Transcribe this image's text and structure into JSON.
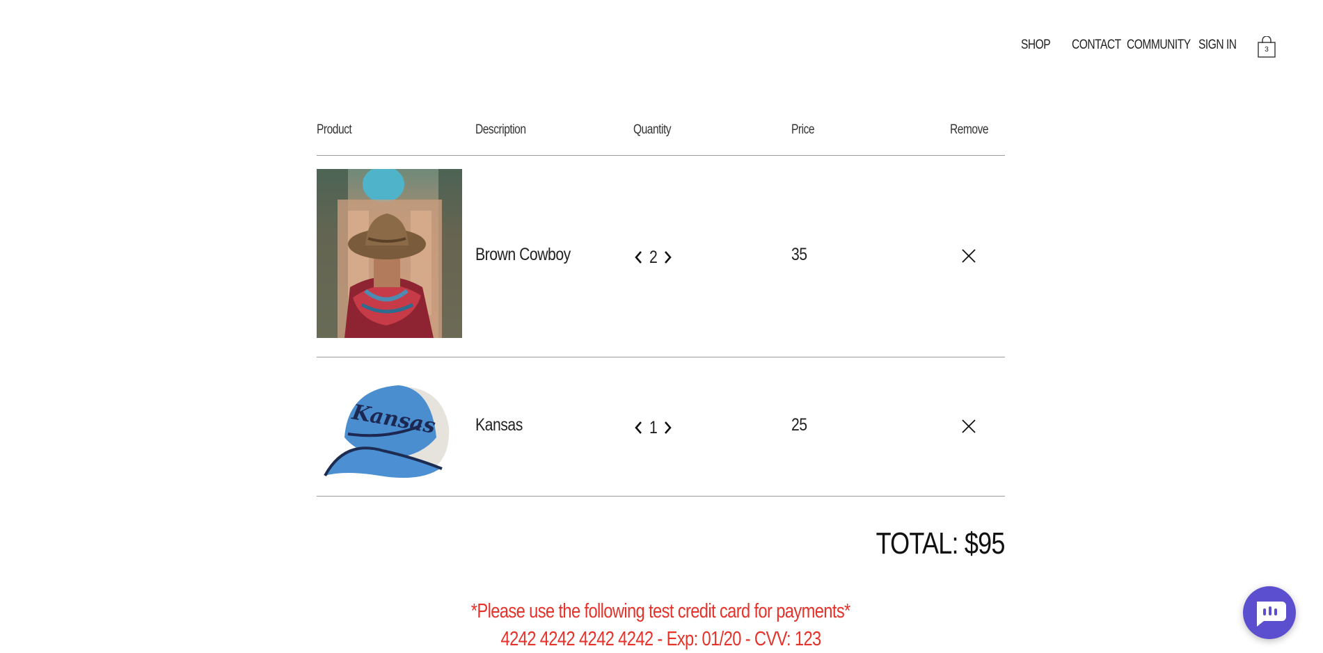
{
  "nav": {
    "items": [
      {
        "label": "SHOP"
      },
      {
        "label": "CONTACT"
      },
      {
        "label": "COMMUNITY"
      },
      {
        "label": "SIGN IN"
      }
    ],
    "cart_count": "3"
  },
  "cart": {
    "headers": {
      "product": "Product",
      "description": "Description",
      "quantity": "Quantity",
      "price": "Price",
      "remove": "Remove"
    },
    "items": [
      {
        "description": "Brown Cowboy",
        "quantity": "2",
        "price": "35",
        "image": "cowboy-hat-photo"
      },
      {
        "description": "Kansas",
        "quantity": "1",
        "price": "25",
        "image": "kansas-cap-photo"
      }
    ],
    "total": "TOTAL: $95"
  },
  "notice": {
    "line1": "*Please use the following test credit card for payments*",
    "line2": "4242 4242 4242 4242 - Exp: 01/20 - CVV: 123"
  },
  "colors": {
    "accent_red": "#e5322b",
    "chat_purple": "#5b4fcf"
  }
}
